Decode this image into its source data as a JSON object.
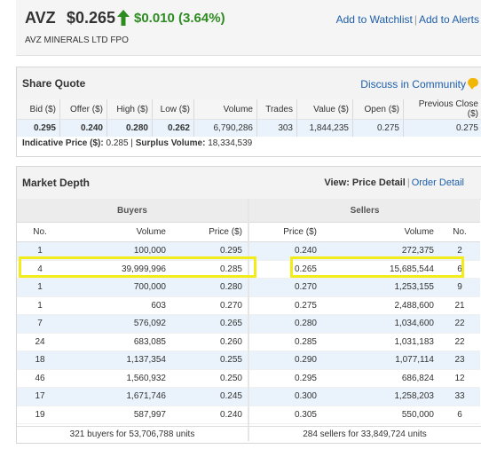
{
  "header": {
    "ticker": "AVZ",
    "price": "$0.265",
    "change": "$0.010 (3.64%)",
    "trend": "up",
    "company": "AVZ MINERALS LTD FPO",
    "watchlist_link": "Add to Watchlist",
    "separator": "|",
    "alerts_link": "Add to Alerts"
  },
  "share_quote": {
    "title": "Share Quote",
    "discuss_link": "Discuss in Community",
    "columns": [
      "Bid ($)",
      "Offer ($)",
      "High ($)",
      "Low ($)",
      "Volume",
      "Trades",
      "Value ($)",
      "Open ($)",
      "Previous Close ($)"
    ],
    "values": [
      "0.295",
      "0.240",
      "0.280",
      "0.262",
      "6,790,286",
      "303",
      "1,844,235",
      "0.275",
      "0.275"
    ],
    "indicative_label": "Indicative Price ($):",
    "indicative_value": "0.285",
    "surplus_label": "Surplus Volume:",
    "surplus_value": "18,334,539"
  },
  "market_depth": {
    "title": "Market Depth",
    "view_label": "View:",
    "view_current": "Price Detail",
    "view_separator": "|",
    "view_other": "Order Detail",
    "buyers_title": "Buyers",
    "sellers_title": "Sellers",
    "buyer_columns": [
      "No.",
      "Volume",
      "Price ($)"
    ],
    "seller_columns": [
      "Price ($)",
      "Volume",
      "No."
    ],
    "buyers": [
      {
        "no": "1",
        "volume": "100,000",
        "price": "0.295"
      },
      {
        "no": "4",
        "volume": "39,999,996",
        "price": "0.285"
      },
      {
        "no": "1",
        "volume": "700,000",
        "price": "0.280"
      },
      {
        "no": "1",
        "volume": "603",
        "price": "0.270"
      },
      {
        "no": "7",
        "volume": "576,092",
        "price": "0.265"
      },
      {
        "no": "24",
        "volume": "683,085",
        "price": "0.260"
      },
      {
        "no": "18",
        "volume": "1,137,354",
        "price": "0.255"
      },
      {
        "no": "46",
        "volume": "1,560,932",
        "price": "0.250"
      },
      {
        "no": "17",
        "volume": "1,671,746",
        "price": "0.245"
      },
      {
        "no": "19",
        "volume": "587,997",
        "price": "0.240"
      }
    ],
    "sellers": [
      {
        "price": "0.240",
        "volume": "272,375",
        "no": "2"
      },
      {
        "price": "0.265",
        "volume": "15,685,544",
        "no": "6"
      },
      {
        "price": "0.270",
        "volume": "1,253,155",
        "no": "9"
      },
      {
        "price": "0.275",
        "volume": "2,488,600",
        "no": "21"
      },
      {
        "price": "0.280",
        "volume": "1,034,600",
        "no": "22"
      },
      {
        "price": "0.285",
        "volume": "1,031,183",
        "no": "22"
      },
      {
        "price": "0.290",
        "volume": "1,077,114",
        "no": "23"
      },
      {
        "price": "0.295",
        "volume": "686,824",
        "no": "12"
      },
      {
        "price": "0.300",
        "volume": "1,258,203",
        "no": "33"
      },
      {
        "price": "0.305",
        "volume": "550,000",
        "no": "6"
      }
    ],
    "buyers_total": "321 buyers for 53,706,788 units",
    "sellers_total": "284 sellers for 33,849,724 units"
  },
  "colors": {
    "up": "#2e8b21",
    "link": "#1e5ea8",
    "highlight": "#f2ed1a",
    "row_alt": "#eaf3fb"
  },
  "icons": [
    "up-arrow-icon",
    "speech-bubble-icon"
  ]
}
